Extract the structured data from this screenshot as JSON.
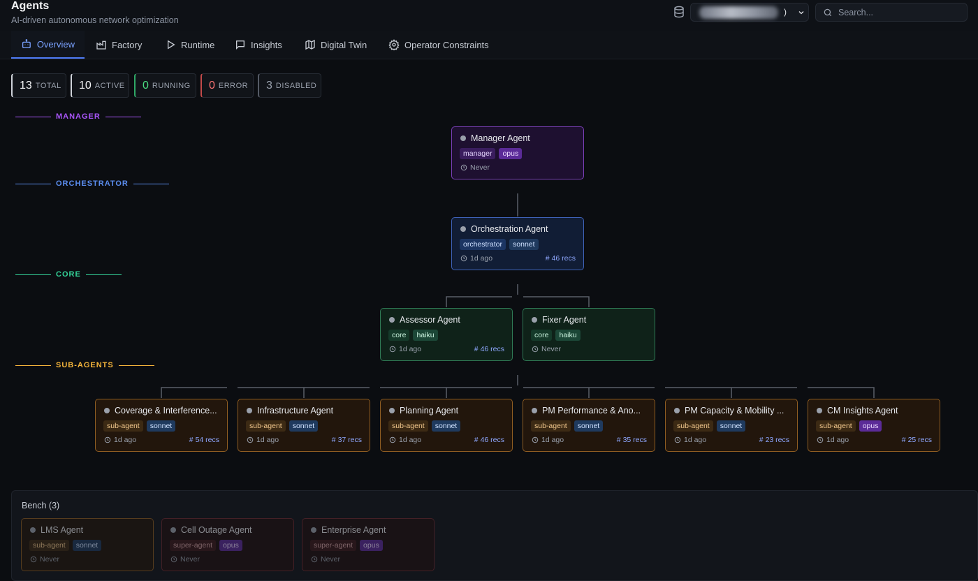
{
  "header": {
    "title": "Agents",
    "subtitle": "AI-driven autonomous network optimization",
    "workspace_suffix": ")",
    "search_placeholder": "Search..."
  },
  "tabs": [
    {
      "label": "Overview",
      "icon": "robot-icon",
      "active": true
    },
    {
      "label": "Factory",
      "icon": "factory-icon"
    },
    {
      "label": "Runtime",
      "icon": "play-icon"
    },
    {
      "label": "Insights",
      "icon": "message-icon"
    },
    {
      "label": "Digital Twin",
      "icon": "map-icon"
    },
    {
      "label": "Operator Constraints",
      "icon": "gear-icon"
    }
  ],
  "stats": [
    {
      "n": "13",
      "label": "TOTAL",
      "color": "#f3f4f6",
      "border": "#cfd3da"
    },
    {
      "n": "10",
      "label": "ACTIVE",
      "color": "#f3f4f6",
      "border": "#cfd3da"
    },
    {
      "n": "0",
      "label": "RUNNING",
      "color": "#4ade80",
      "border": "#2fa866"
    },
    {
      "n": "0",
      "label": "ERROR",
      "color": "#f87171",
      "border": "#c24a4a"
    },
    {
      "n": "3",
      "label": "DISABLED",
      "color": "#9aa1ad",
      "border": "#555b66"
    }
  ],
  "levels": {
    "manager": "MANAGER",
    "orchestrator": "ORCHESTRATOR",
    "core": "CORE",
    "sub_agents": "SUB-AGENTS"
  },
  "level_colors": {
    "manager": "#a855f7",
    "orchestrator": "#5b8def",
    "core": "#34d399",
    "sub_agents": "#f5b53b"
  },
  "agents": {
    "manager": {
      "name": "Manager Agent",
      "role": "manager",
      "model": "opus",
      "time": "Never"
    },
    "orchestrator": {
      "name": "Orchestration Agent",
      "role": "orchestrator",
      "model": "sonnet",
      "time": "1d ago",
      "recs": "46 recs"
    },
    "core": [
      {
        "name": "Assessor Agent",
        "role": "core",
        "model": "haiku",
        "time": "1d ago",
        "recs": "46 recs"
      },
      {
        "name": "Fixer Agent",
        "role": "core",
        "model": "haiku",
        "time": "Never"
      }
    ],
    "sub": [
      {
        "name": "Coverage & Interference...",
        "role": "sub-agent",
        "model": "sonnet",
        "time": "1d ago",
        "recs": "54 recs"
      },
      {
        "name": "Infrastructure Agent",
        "role": "sub-agent",
        "model": "sonnet",
        "time": "1d ago",
        "recs": "37 recs"
      },
      {
        "name": "Planning Agent",
        "role": "sub-agent",
        "model": "sonnet",
        "time": "1d ago",
        "recs": "46 recs"
      },
      {
        "name": "PM Performance & Ano...",
        "role": "sub-agent",
        "model": "sonnet",
        "time": "1d ago",
        "recs": "35 recs"
      },
      {
        "name": "PM Capacity & Mobility ...",
        "role": "sub-agent",
        "model": "sonnet",
        "time": "1d ago",
        "recs": "23 recs"
      },
      {
        "name": "CM Insights Agent",
        "role": "sub-agent",
        "model": "opus",
        "time": "1d ago",
        "recs": "25 recs"
      }
    ]
  },
  "bench": {
    "title": "Bench (3)",
    "agents": [
      {
        "name": "LMS Agent",
        "role": "sub-agent",
        "model": "sonnet",
        "time": "Never"
      },
      {
        "name": "Cell Outage Agent",
        "role": "super-agent",
        "model": "opus",
        "time": "Never"
      },
      {
        "name": "Enterprise Agent",
        "role": "super-agent",
        "model": "opus",
        "time": "Never"
      }
    ]
  }
}
